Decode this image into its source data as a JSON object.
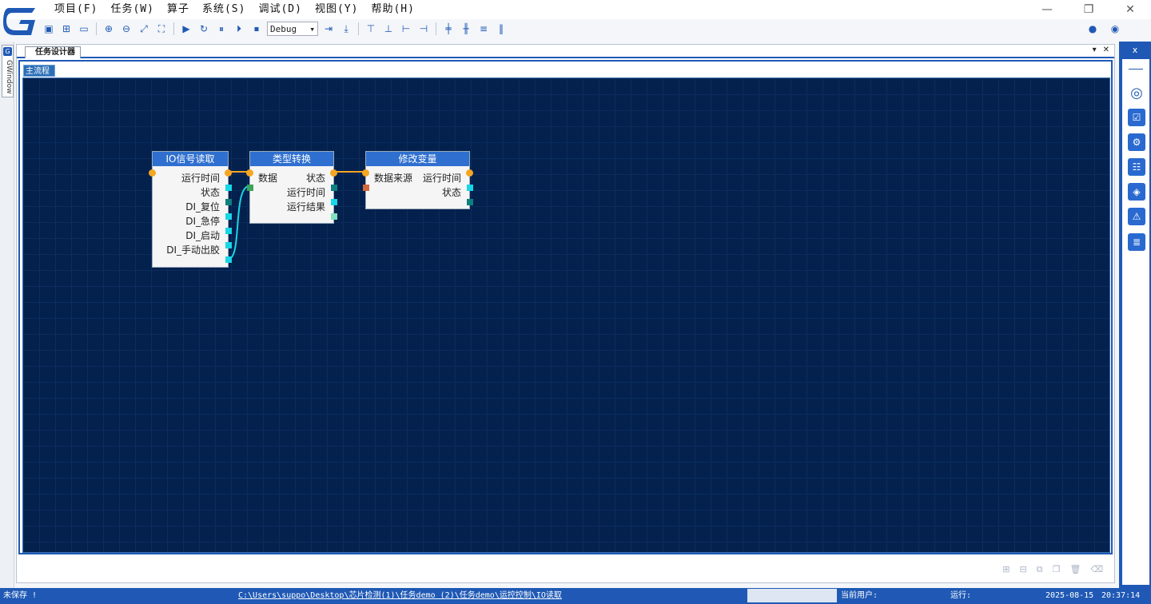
{
  "menu": [
    "项目(F)",
    "任务(W)",
    "算子",
    "系统(S)",
    "调试(D)",
    "视图(Y)",
    "帮助(H)"
  ],
  "toolbar": {
    "mode": "Debug"
  },
  "left_tab": "GWindow",
  "doc_tab": "任务设计器",
  "sub_tab": "主流程",
  "nodes": {
    "io": {
      "title": "IO信号读取",
      "outputs": [
        "运行时间",
        "状态",
        "DI_复位",
        "DI_急停",
        "DI_启动",
        "DI_手动出胶"
      ]
    },
    "convert": {
      "title": "类型转换",
      "input": "数据",
      "outputs": [
        "状态",
        "运行时间",
        "运行结果"
      ]
    },
    "modify": {
      "title": "修改变量",
      "input": "数据来源",
      "outputs": [
        "运行时间",
        "状态"
      ]
    }
  },
  "right_panel": {
    "close": "x"
  },
  "status": {
    "saved": "未保存 !",
    "path": "C:\\Users\\suppo\\Desktop\\芯片检测(1)\\任务demo (2)\\任务demo\\运控控制\\IO读取",
    "user_label": "当前用户:",
    "run_label": "运行:",
    "date": "2025-08-15",
    "time": "20:37:14"
  },
  "colors": {
    "accent": "#1f59b5",
    "canvas": "#04214e",
    "node_header": "#2f6fcf",
    "flow": "#f5a623"
  }
}
